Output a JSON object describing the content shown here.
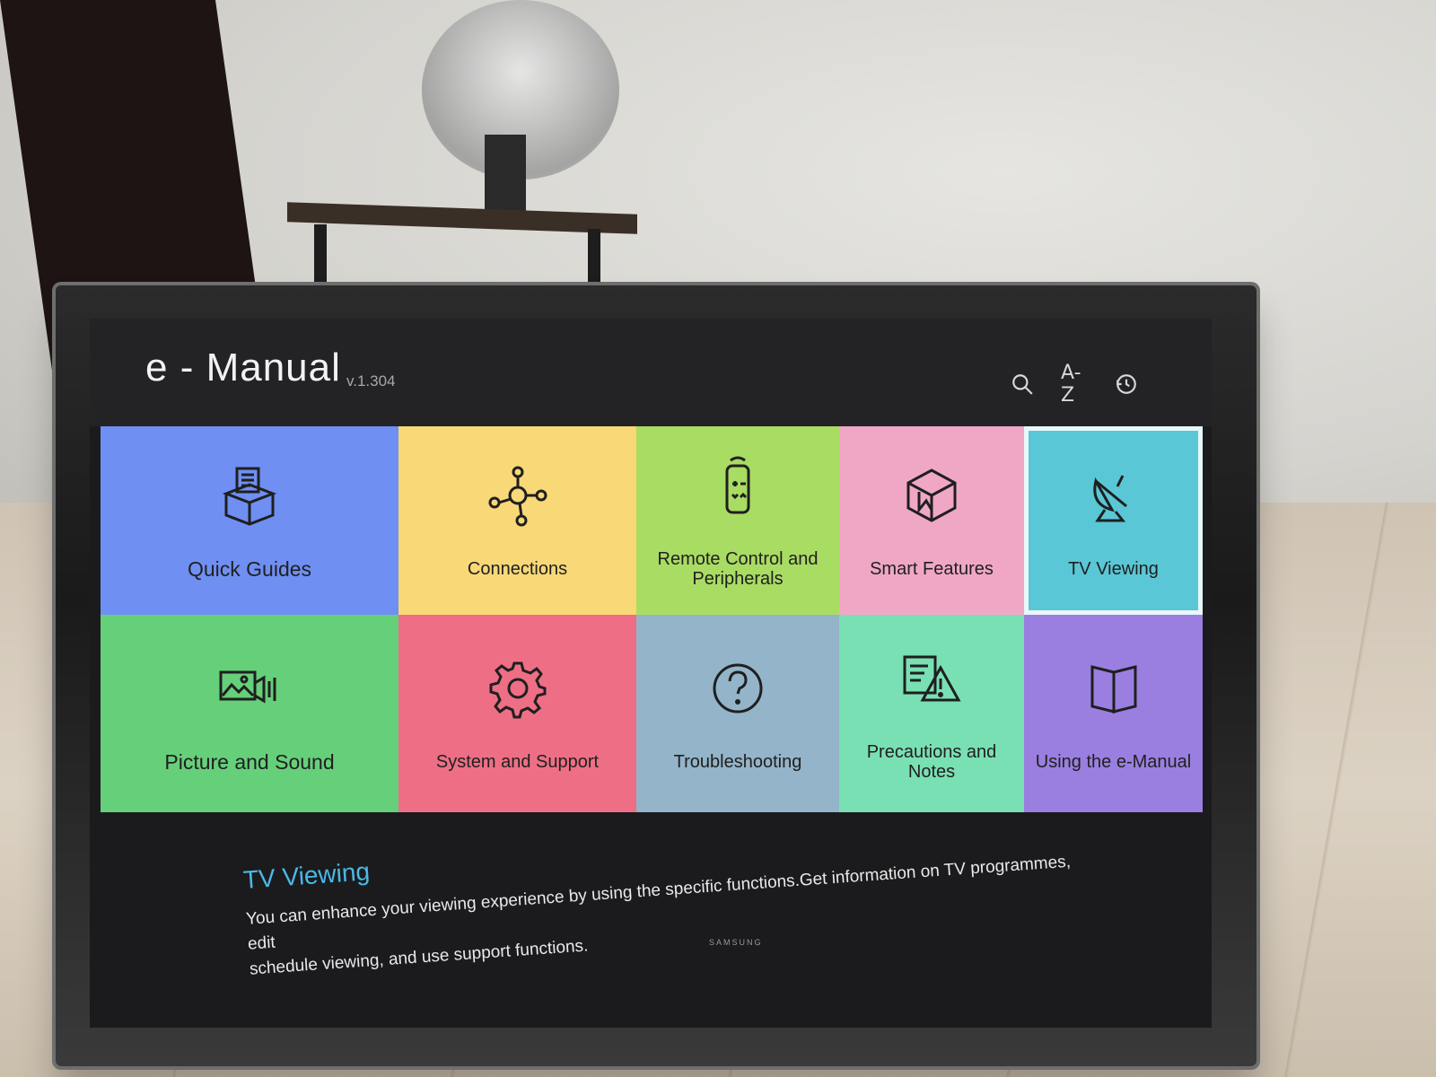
{
  "app": {
    "title": "e - Manual",
    "version": "v.1.304"
  },
  "header": {
    "icons": [
      {
        "name": "search-icon",
        "glyph": "search"
      },
      {
        "name": "az-index-icon",
        "glyph": "A-Z"
      },
      {
        "name": "history-icon",
        "glyph": "recent"
      }
    ],
    "az_label": "A-Z"
  },
  "tiles": [
    {
      "label": "Quick Guides",
      "color": "#6f8ff2",
      "icon": "box-guide-icon"
    },
    {
      "label": "Connections",
      "color": "#f8d877",
      "icon": "network-hub-icon"
    },
    {
      "label": "Remote Control and Peripherals",
      "color": "#a9dc63",
      "icon": "remote-control-icon"
    },
    {
      "label": "Smart Features",
      "color": "#f0a7c6",
      "icon": "smart-cube-icon"
    },
    {
      "label": "TV Viewing",
      "color": "#5ac7d6",
      "icon": "satellite-dish-icon",
      "selected": true
    },
    {
      "label": "Picture and Sound",
      "color": "#66cf7a",
      "icon": "picture-sound-icon"
    },
    {
      "label": "System and Support",
      "color": "#ee6f85",
      "icon": "gear-icon"
    },
    {
      "label": "Troubleshooting",
      "color": "#93b4c9",
      "icon": "question-icon"
    },
    {
      "label": "Precautions and Notes",
      "color": "#79e0b4",
      "icon": "warning-note-icon"
    },
    {
      "label": "Using the e-Manual",
      "color": "#9a7fe0",
      "icon": "open-book-icon"
    }
  ],
  "description": {
    "title": "TV Viewing",
    "text_line1": "You can enhance your viewing experience by using the specific functions.Get information on TV programmes, edit",
    "text_line2": "schedule viewing, and use support functions."
  },
  "brand": "SAMSUNG"
}
